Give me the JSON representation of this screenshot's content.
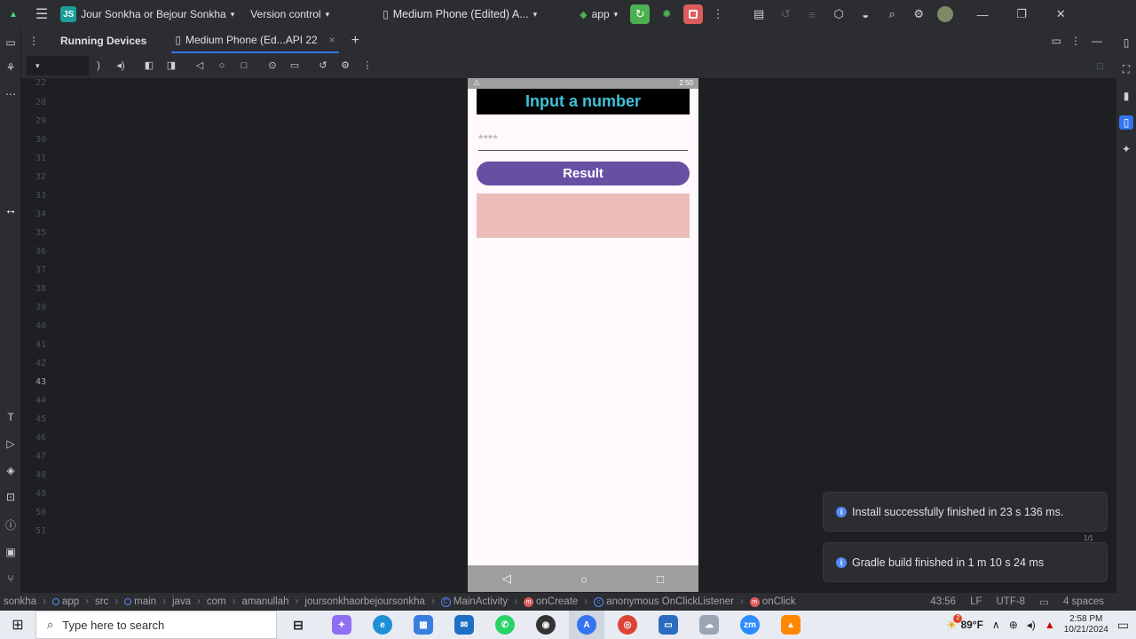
{
  "ide": {
    "project_badge": "JS",
    "project_name": "Jour Sonkha or Bejour Sonkha",
    "version_control": "Version control",
    "device_title": "Medium Phone (Edited) A...",
    "run_config": "app",
    "colors": {
      "accent": "#3574f0",
      "run": "#4caf50",
      "stop": "#db5c5c"
    }
  },
  "tabs": {
    "running_devices": "Running Devices",
    "device_tab": "Medium Phone (Ed...API 22"
  },
  "gutter": {
    "lines": [
      "22",
      "28",
      "29",
      "30",
      "31",
      "32",
      "33",
      "34",
      "35",
      "36",
      "37",
      "38",
      "39",
      "40",
      "41",
      "42",
      "43",
      "44",
      "45",
      "46",
      "47",
      "48",
      "49",
      "50",
      "51"
    ],
    "current_line": "43"
  },
  "phone": {
    "status_time": "2:50",
    "title": "Input a number",
    "input_placeholder": "****",
    "input_value": "",
    "button_label": "Result",
    "result_text": "",
    "colors": {
      "title_bg": "#000000",
      "title_text": "#3fc1d9",
      "button": "#6750a4",
      "result_bg": "#ecbcbb"
    }
  },
  "notifications": [
    {
      "text": "Install successfully finished in 23 s 136 ms."
    },
    {
      "text": "Gradle build finished in 1 m 10 s 24 ms"
    }
  ],
  "notification_count": "1/1",
  "breadcrumb": [
    "sonkha",
    "app",
    "src",
    "main",
    "java",
    "com",
    "amanullah",
    "joursonkhaorbejoursonkha",
    "MainActivity",
    "onCreate",
    "anonymous OnClickListener",
    "onClick"
  ],
  "status": {
    "position": "43:56",
    "line_sep": "LF",
    "encoding": "UTF-8",
    "indent": "4 spaces"
  },
  "taskbar": {
    "search_placeholder": "Type here to search",
    "weather": "89°F",
    "time": "2:58 PM",
    "date": "10/21/2024",
    "weather_badge": "2"
  }
}
